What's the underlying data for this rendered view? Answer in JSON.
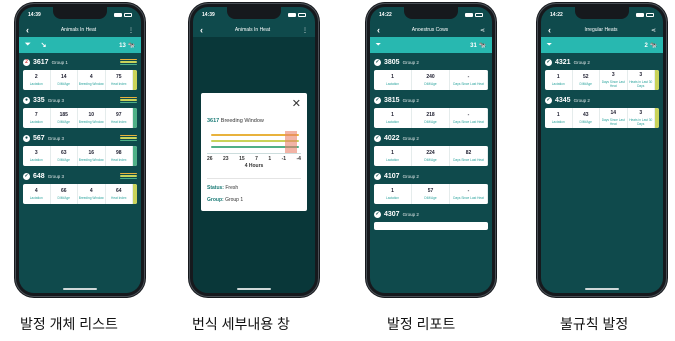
{
  "colors": {
    "screen_bg": "#0f4a4c",
    "filter_bar": "#28b8b0",
    "accent_label": "#2aa39d"
  },
  "phones": [
    {
      "status_time": "14:39",
      "title": "Animals In Heat",
      "count": "13",
      "cows": [
        {
          "badge": "2",
          "id": "3617",
          "group": "Group 1",
          "values": [
            "2",
            "14",
            "4",
            "75"
          ],
          "labels": [
            "Lactation",
            "DIM/Age",
            "Breeding Window",
            "Heat Index"
          ]
        },
        {
          "badge": "",
          "id": "335",
          "group": "Group 3",
          "values": [
            "7",
            "185",
            "10",
            "97"
          ],
          "labels": [
            "Lactation",
            "DIM/Age",
            "Breeding Window",
            "Heat Index"
          ]
        },
        {
          "badge": "",
          "id": "567",
          "group": "Group 3",
          "values": [
            "3",
            "63",
            "16",
            "98"
          ],
          "labels": [
            "Lactation",
            "DIM/Age",
            "Breeding Window",
            "Heat Index"
          ]
        },
        {
          "badge": "",
          "id": "648",
          "group": "Group 3",
          "values": [
            "4",
            "66",
            "4",
            "64"
          ],
          "labels": [
            "Lactation",
            "DIM/Age",
            "Breeding Window",
            "Heat Index"
          ]
        }
      ]
    },
    {
      "status_time": "14:39",
      "title": "Animals In Heat",
      "modal": {
        "cow_id": "3617",
        "title": "Breeding Window",
        "ticks": [
          "26",
          "23",
          "15",
          "7",
          "1",
          "-1",
          "-4"
        ],
        "hours": "4 Hours",
        "status_label": "Status:",
        "status_value": "Fresh",
        "group_label": "Group:",
        "group_value": "Group 1"
      }
    },
    {
      "status_time": "14:22",
      "title": "Anoestrus Cows",
      "count": "31",
      "cows": [
        {
          "id": "3805",
          "group": "Group 2",
          "values": [
            "1",
            "240",
            "-"
          ],
          "labels": [
            "Lactation",
            "DIM/Age",
            "Days Since Last Heat"
          ]
        },
        {
          "id": "3815",
          "group": "Group 2",
          "values": [
            "1",
            "218",
            "-"
          ],
          "labels": [
            "Lactation",
            "DIM/Age",
            "Days Since Last Heat"
          ]
        },
        {
          "id": "4022",
          "group": "Group 2",
          "values": [
            "1",
            "224",
            "82"
          ],
          "labels": [
            "Lactation",
            "DIM/Age",
            "Days Since Last Heat"
          ]
        },
        {
          "id": "4107",
          "group": "Group 2",
          "values": [
            "1",
            "57",
            "-"
          ],
          "labels": [
            "Lactation",
            "DIM/Age",
            "Days Since Last Heat"
          ]
        },
        {
          "id": "4307",
          "group": "Group 2",
          "values": [
            "",
            "",
            ""
          ],
          "labels": [
            "",
            "",
            ""
          ]
        }
      ]
    },
    {
      "status_time": "14:22",
      "title": "Irregular Heats",
      "count": "2",
      "cows": [
        {
          "id": "4321",
          "group": "Group 2",
          "values": [
            "1",
            "52",
            "3",
            "3"
          ],
          "labels": [
            "Lactation",
            "DIM/Age",
            "Days Since Last Heat",
            "Heats in Last 30 Days"
          ]
        },
        {
          "id": "4345",
          "group": "Group 2",
          "values": [
            "1",
            "43",
            "14",
            "3"
          ],
          "labels": [
            "Lactation",
            "DIM/Age",
            "Days Since Last Heat",
            "Heats in Last 30 Days"
          ]
        }
      ]
    }
  ],
  "captions": [
    "발정 개체 리스트",
    "번식 세부내용 창",
    "발정 리포트",
    "불규칙 발정"
  ]
}
